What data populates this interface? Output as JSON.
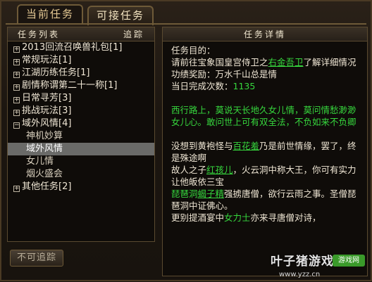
{
  "tabs": {
    "current": "当前任务",
    "available": "可接任务"
  },
  "left_panel": {
    "header_list": "任务列表",
    "header_track": "追踪",
    "items": [
      {
        "label": "2013回流召唤兽礼包[1]",
        "type": "collapsed"
      },
      {
        "label": "常规玩法[1]",
        "type": "collapsed"
      },
      {
        "label": "江湖历练任务[1]",
        "type": "collapsed"
      },
      {
        "label": "剧情称谓第二十一称[1]",
        "type": "collapsed"
      },
      {
        "label": "日常寻芳[3]",
        "type": "collapsed"
      },
      {
        "label": "挑战玩法[3]",
        "type": "collapsed"
      },
      {
        "label": "域外风情[4]",
        "type": "expanded"
      },
      {
        "label": "神机妙算",
        "type": "sub"
      },
      {
        "label": "域外风情",
        "type": "sub-selected"
      },
      {
        "label": "女儿情",
        "type": "sub"
      },
      {
        "label": "烟火盛会",
        "type": "sub"
      },
      {
        "label": "其他任务[2]",
        "type": "collapsed"
      }
    ]
  },
  "right_panel": {
    "header": "任务详情",
    "goal_label": "任务目的：",
    "goal_pre": "请前往宝象国皇宫侍卫之",
    "goal_link": "右金吾卫",
    "goal_post": "了解详细情况",
    "reward": "功绩奖励：万水千山总是情",
    "done_label": "当日完成次数：",
    "done_count": "1135",
    "poem": "西行路上，莫说天长地久女儿情，莫问情愁渺渺女儿心。敢问世上可有双全法，不负如来不负卿",
    "story1_pre": "没想到黄袍怪与",
    "story1_link": "百花羞",
    "story1_post": "乃是前世情缘，罢了，终是殊途啊",
    "story2_pre": "故人之子",
    "story2_link": "红孩儿",
    "story2_post": "，火云洞中称大王，你可有实力让他皈依三宝",
    "story3_pre": "琵琶洞",
    "story3_link": "蝎子精",
    "story3_post": "强掳唐僧，欲行云雨之事。圣僧琵琶洞中证佛心。",
    "story4_pre": "更别提酒宴中",
    "story4_link": "女力士",
    "story4_post": "亦来寻唐僧对诗，"
  },
  "footer": {
    "untrack_button": "不可追踪"
  },
  "watermark": {
    "title": "叶子猪游戏",
    "badge": "游戏网",
    "url": "www.yzz.cn"
  },
  "colors": {
    "accent_green": "#36d63d",
    "selection": "#6a6a68",
    "border": "#6e5a38"
  }
}
